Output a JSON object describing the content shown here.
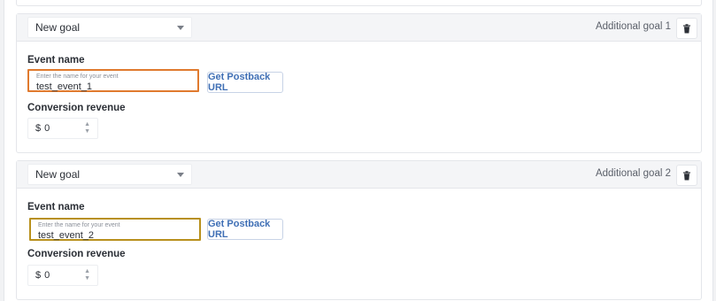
{
  "goals": [
    {
      "select_value": "New goal",
      "label": "Additional goal 1",
      "event_name_title": "Event name",
      "event_placeholder": "Enter the name for your event",
      "event_value": "test_event_1",
      "event_border_color": "#e07a2e",
      "postback_button": "Get Postback URL",
      "revenue_title": "Conversion revenue",
      "currency": "$",
      "revenue_value": "0"
    },
    {
      "select_value": "New goal",
      "label": "Additional goal 2",
      "event_name_title": "Event name",
      "event_placeholder": "Enter the name for your event",
      "event_value": "test_event_2",
      "event_border_color": "#b8901c",
      "postback_button": "Get Postback URL",
      "revenue_title": "Conversion revenue",
      "currency": "$",
      "revenue_value": "0"
    }
  ],
  "icons": {
    "select_chevron": "chevron-down-icon",
    "delete": "trash-icon",
    "stepper": "stepper-arrows-icon"
  },
  "colors": {
    "accent_blue": "#3f6fb5",
    "header_bg": "#f4f5f7",
    "border": "#e4e6ea"
  }
}
